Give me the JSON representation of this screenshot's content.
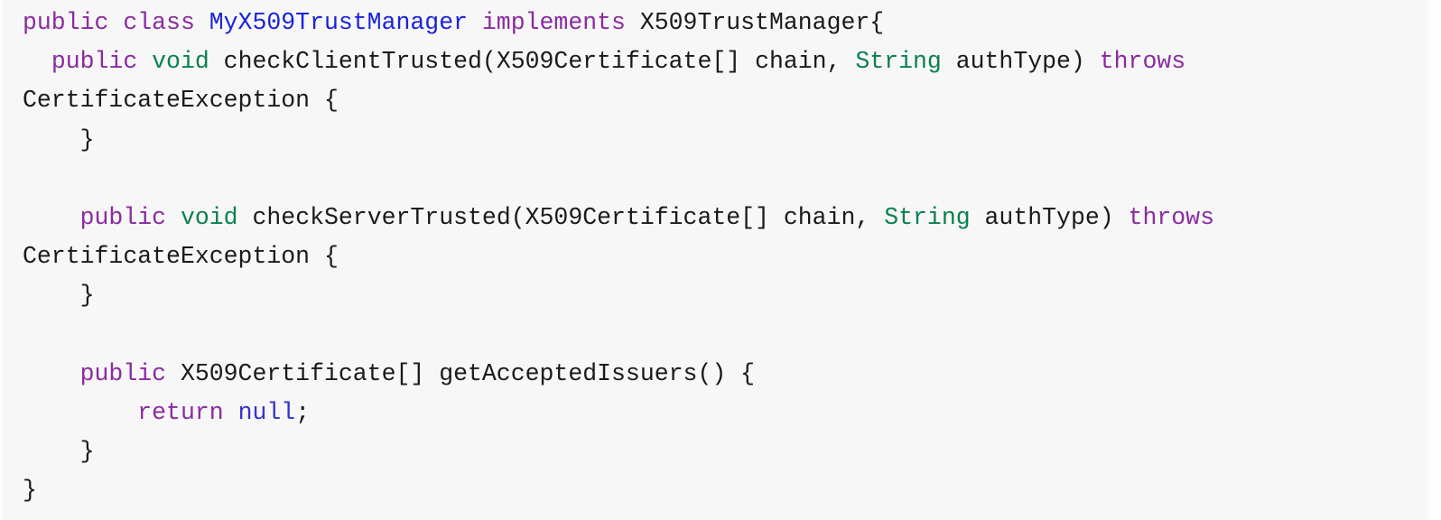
{
  "editor": {
    "language": "java",
    "background_color": "#f7f7f7",
    "font_size_px": 26.5,
    "colors": {
      "keyword": "#8a2ba0",
      "class_name": "#1a23d8",
      "type": "#0b8050",
      "literal": "#3333cc",
      "plain": "#1a1a1a",
      "background": "#f7f7f7"
    }
  },
  "code": {
    "lines": [
      {
        "id": "line-1",
        "tokens": [
          {
            "t": "public",
            "c": "kw"
          },
          {
            "t": " ",
            "c": "pln"
          },
          {
            "t": "class",
            "c": "kw"
          },
          {
            "t": " ",
            "c": "pln"
          },
          {
            "t": "MyX509TrustManager",
            "c": "typ"
          },
          {
            "t": " ",
            "c": "pln"
          },
          {
            "t": "implements",
            "c": "kw"
          },
          {
            "t": " X509TrustManager{",
            "c": "pln"
          }
        ]
      },
      {
        "id": "line-2",
        "tokens": [
          {
            "t": "  ",
            "c": "pln"
          },
          {
            "t": "public",
            "c": "kw"
          },
          {
            "t": " ",
            "c": "pln"
          },
          {
            "t": "void",
            "c": "str"
          },
          {
            "t": " checkClientTrusted(X509Certificate[] chain, ",
            "c": "pln"
          },
          {
            "t": "String",
            "c": "str"
          },
          {
            "t": " authType) ",
            "c": "pln"
          },
          {
            "t": "throws",
            "c": "kw"
          }
        ]
      },
      {
        "id": "line-3",
        "tokens": [
          {
            "t": "CertificateException {",
            "c": "pln"
          }
        ]
      },
      {
        "id": "line-4",
        "tokens": [
          {
            "t": "    }",
            "c": "pln"
          }
        ]
      },
      {
        "id": "line-5",
        "tokens": [
          {
            "t": "",
            "c": "pln"
          }
        ]
      },
      {
        "id": "line-6",
        "tokens": [
          {
            "t": "    ",
            "c": "pln"
          },
          {
            "t": "public",
            "c": "kw"
          },
          {
            "t": " ",
            "c": "pln"
          },
          {
            "t": "void",
            "c": "str"
          },
          {
            "t": " checkServerTrusted(X509Certificate[] chain, ",
            "c": "pln"
          },
          {
            "t": "String",
            "c": "str"
          },
          {
            "t": " authType) ",
            "c": "pln"
          },
          {
            "t": "throws",
            "c": "kw"
          }
        ]
      },
      {
        "id": "line-7",
        "tokens": [
          {
            "t": "CertificateException {",
            "c": "pln"
          }
        ]
      },
      {
        "id": "line-8",
        "tokens": [
          {
            "t": "    }",
            "c": "pln"
          }
        ]
      },
      {
        "id": "line-9",
        "tokens": [
          {
            "t": "",
            "c": "pln"
          }
        ]
      },
      {
        "id": "line-10",
        "tokens": [
          {
            "t": "    ",
            "c": "pln"
          },
          {
            "t": "public",
            "c": "kw"
          },
          {
            "t": " X509Certificate[] getAcceptedIssuers() {",
            "c": "pln"
          }
        ]
      },
      {
        "id": "line-11",
        "tokens": [
          {
            "t": "        ",
            "c": "pln"
          },
          {
            "t": "return",
            "c": "kw"
          },
          {
            "t": " ",
            "c": "pln"
          },
          {
            "t": "null",
            "c": "lit"
          },
          {
            "t": ";",
            "c": "pln"
          }
        ]
      },
      {
        "id": "line-12",
        "tokens": [
          {
            "t": "    }",
            "c": "pln"
          }
        ]
      },
      {
        "id": "line-13",
        "tokens": [
          {
            "t": "}",
            "c": "pln"
          }
        ]
      }
    ]
  }
}
